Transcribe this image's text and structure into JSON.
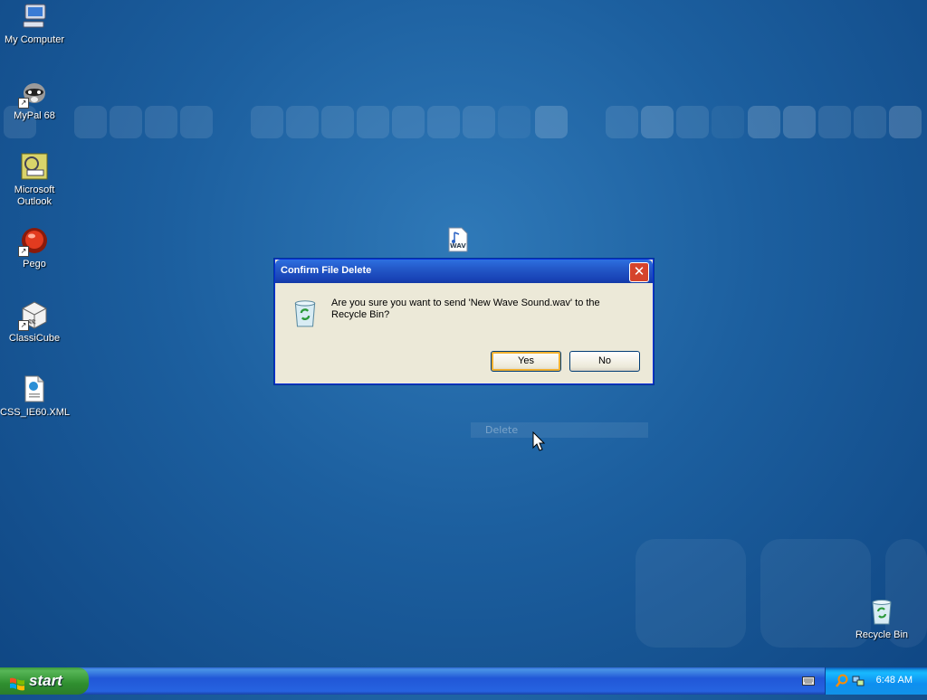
{
  "desktop": {
    "icons": [
      {
        "label": "My Computer",
        "icon": "my-computer-icon"
      },
      {
        "label": "MyPal 68",
        "icon": "mypal-icon"
      },
      {
        "label": "Microsoft Outlook",
        "icon": "outlook-icon"
      },
      {
        "label": "Pego",
        "icon": "pego-icon"
      },
      {
        "label": "ClassiCube",
        "icon": "classicube-icon"
      },
      {
        "label": "CSS_IE60.XML",
        "icon": "xml-file-icon"
      },
      {
        "label": "Recycle Bin",
        "icon": "recycle-bin-icon"
      }
    ],
    "wav_file_badge": "WAV",
    "context_menu_item": "Delete"
  },
  "dialog": {
    "title": "Confirm File Delete",
    "close_symbol": "✕",
    "message": "Are you sure you want to send 'New Wave Sound.wav' to the Recycle Bin?",
    "yes_label": "Yes",
    "no_label": "No"
  },
  "taskbar": {
    "start_label": "start",
    "clock": "6:48 AM"
  },
  "colors": {
    "desktop_bg": "#1c5f9f",
    "dialog_bg": "#ece9d8",
    "titlebar": "#2358c8",
    "close_button": "#d5442c",
    "start_green": "#2f8f2f",
    "tray_blue": "#0e8ff0"
  }
}
